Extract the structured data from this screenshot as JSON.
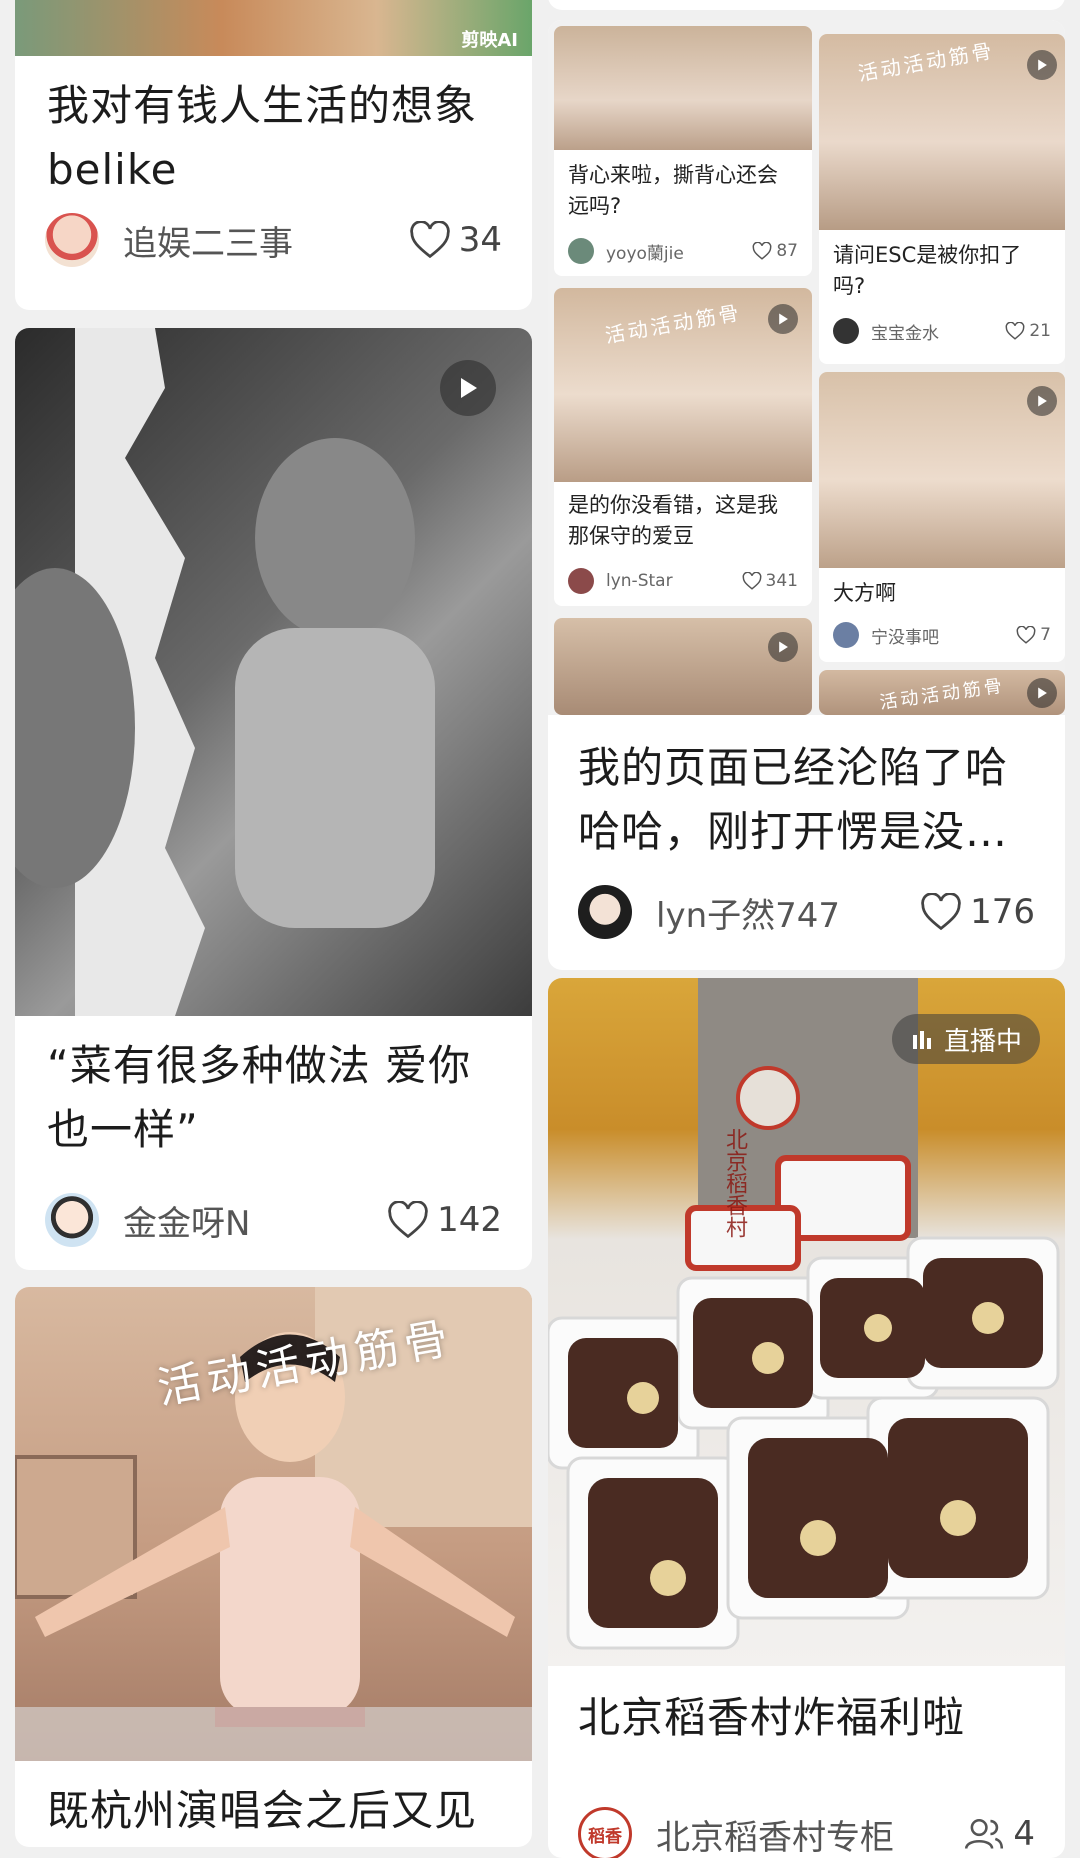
{
  "colors": {
    "page_bg": "#f0f0f0",
    "card_bg": "#ffffff",
    "text_primary": "#1c1c1c",
    "text_secondary": "#555555"
  },
  "cards": {
    "c1": {
      "title": "我对有钱人生活的想象belike",
      "author": "追娱二三事",
      "likes": "34",
      "image_caption": "剪映AI"
    },
    "c2": {
      "title": "“菜有很多种做法 爱你也一样”",
      "author": "金金呀N",
      "likes": "142"
    },
    "c3": {
      "title": "既杭州演唱会之后又见",
      "overlay_text": "活动活动筋骨"
    },
    "c4": {
      "title": "我的页面已经沦陷了哈哈哈，刚打开愣是没…",
      "author": "lyn子然747",
      "likes": "176",
      "minis": [
        {
          "title": "背心来啦，撕背心还会远吗?",
          "author": "yoyo蘭jie",
          "likes": "87"
        },
        {
          "title": "请问ESC是被你扣了吗?",
          "author": "宝宝金水",
          "likes": "21",
          "overlay": "活动活动筋骨"
        },
        {
          "title": "是的你没看错，这是我那保守的爱豆",
          "author": "lyn-Star",
          "likes": "341",
          "overlay": "活动活动筋骨"
        },
        {
          "title": "大方啊",
          "author": "宁没事吧",
          "likes": "7"
        },
        {
          "overlay": ""
        },
        {
          "overlay": "活动活动筋骨"
        }
      ]
    },
    "c5": {
      "title": "北京稻香村炸福利啦",
      "author": "北京稻香村专柜",
      "viewers": "4",
      "live_badge": "直播中",
      "apron_text": "北京稻香村",
      "avatar_text": "稻香"
    }
  }
}
